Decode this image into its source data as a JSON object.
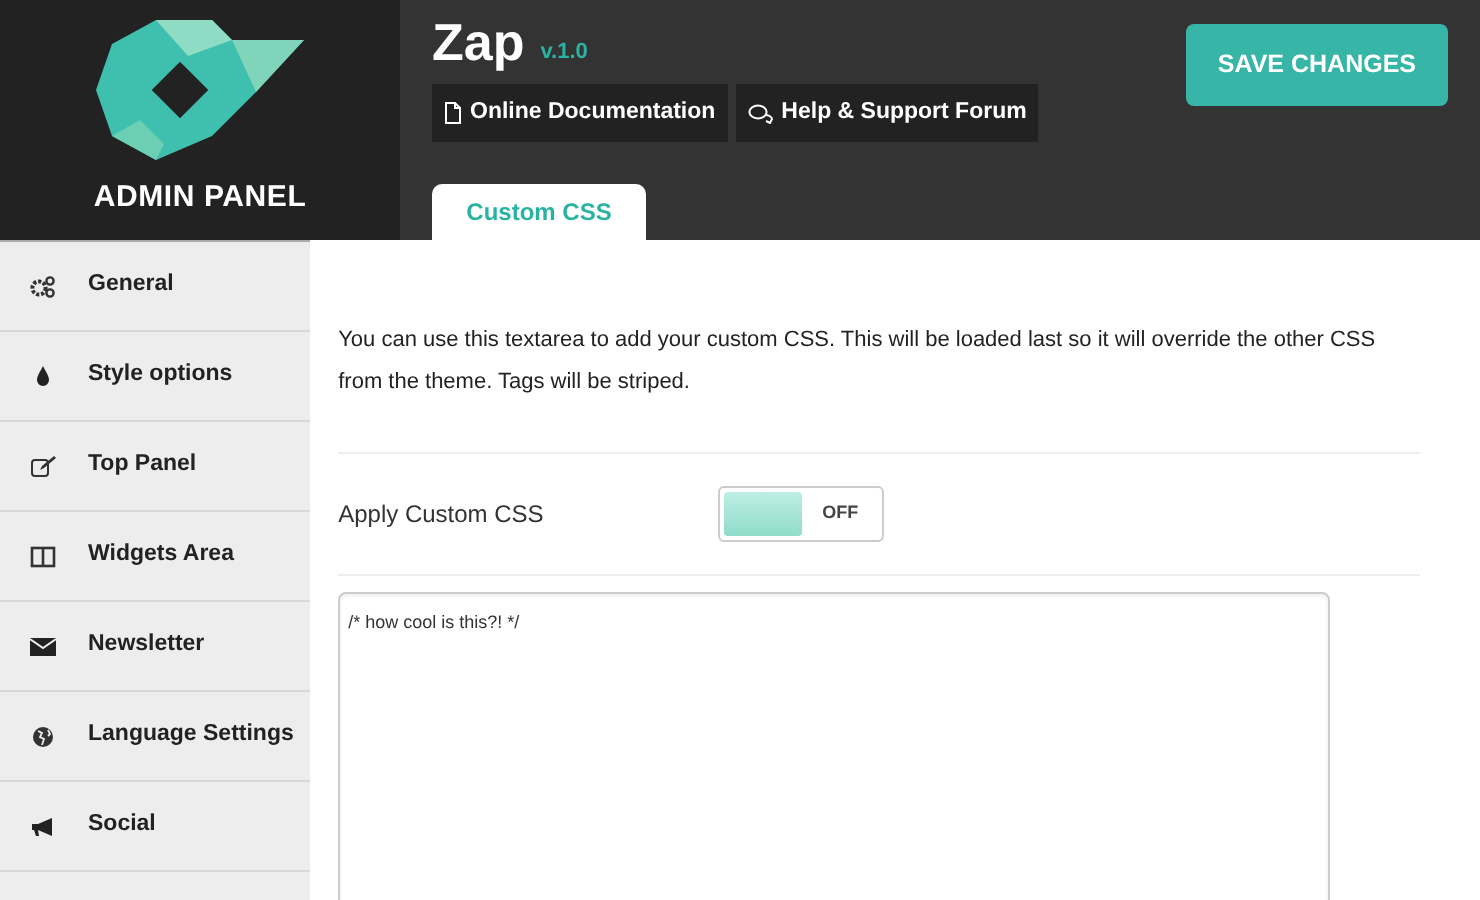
{
  "logo": {
    "caption": "ADMIN PANEL"
  },
  "header": {
    "title": "Zap",
    "version": "v.1.0",
    "links": [
      {
        "kind": "doc",
        "label": "Online Documentation"
      },
      {
        "kind": "forum",
        "label": "Help & Support Forum"
      }
    ],
    "save_button": "SAVE CHANGES"
  },
  "tabs": [
    {
      "label": "Custom CSS",
      "selected": true
    }
  ],
  "sidebar": {
    "items": [
      {
        "kind": "gears",
        "label": "General"
      },
      {
        "kind": "drop",
        "label": "Style options"
      },
      {
        "kind": "edit",
        "label": "Top Panel"
      },
      {
        "kind": "columns",
        "label": "Widgets Area"
      },
      {
        "kind": "mail",
        "label": "Newsletter"
      },
      {
        "kind": "globe",
        "label": "Language Settings"
      },
      {
        "kind": "megaphone",
        "label": "Social"
      }
    ]
  },
  "description": "You can use this textarea to add your custom CSS. This will be loaded last so it will override the other CSS from the theme. Tags will be striped.",
  "apply_custom_css": {
    "label": "Apply Custom CSS",
    "on": false,
    "off_text": "OFF"
  },
  "css_editor": {
    "value": "/* how cool is this?! */\n"
  }
}
